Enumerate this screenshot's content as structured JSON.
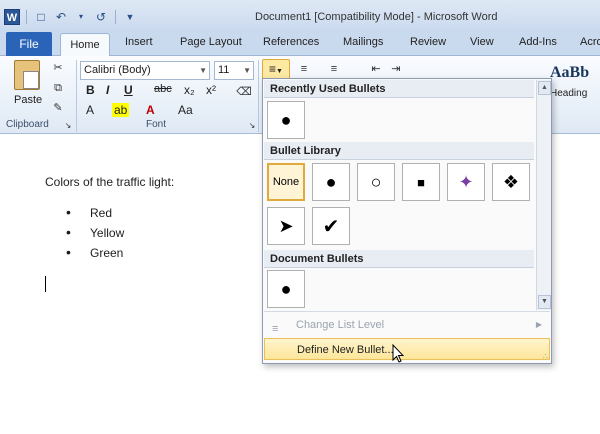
{
  "window": {
    "title": "Document1 [Compatibility Mode] - Microsoft Word",
    "app_icon_letter": "W"
  },
  "tabs": {
    "file": "File",
    "items": [
      "Home",
      "Insert",
      "Page Layout",
      "References",
      "Mailings",
      "Review",
      "View",
      "Add-Ins",
      "Acro"
    ],
    "active": "Home"
  },
  "ribbon": {
    "clipboard": {
      "paste_label": "Paste",
      "group_label": "Clipboard"
    },
    "font": {
      "font_name": "Calibri (Body)",
      "font_size": "11",
      "group_label": "Font",
      "bold": "B",
      "italic": "I",
      "underline": "U",
      "strike": "abc",
      "subscript": "x₂",
      "superscript": "x²",
      "grow": "A",
      "change_case": "Aa"
    },
    "styles": {
      "sample": "AaBb",
      "name": "Heading"
    }
  },
  "document": {
    "intro": "Colors of the traffic light:",
    "list": [
      "Red",
      "Yellow",
      "Green"
    ]
  },
  "dropdown": {
    "recent_heading": "Recently Used Bullets",
    "library_heading": "Bullet Library",
    "document_heading": "Document Bullets",
    "none_label": "None",
    "change_level": "Change List Level",
    "define_new": "Define New Bullet..."
  },
  "colors": {
    "file_tab": "#2a64b8",
    "highlight": "#fde69a",
    "selection_border": "#e0a93a"
  }
}
